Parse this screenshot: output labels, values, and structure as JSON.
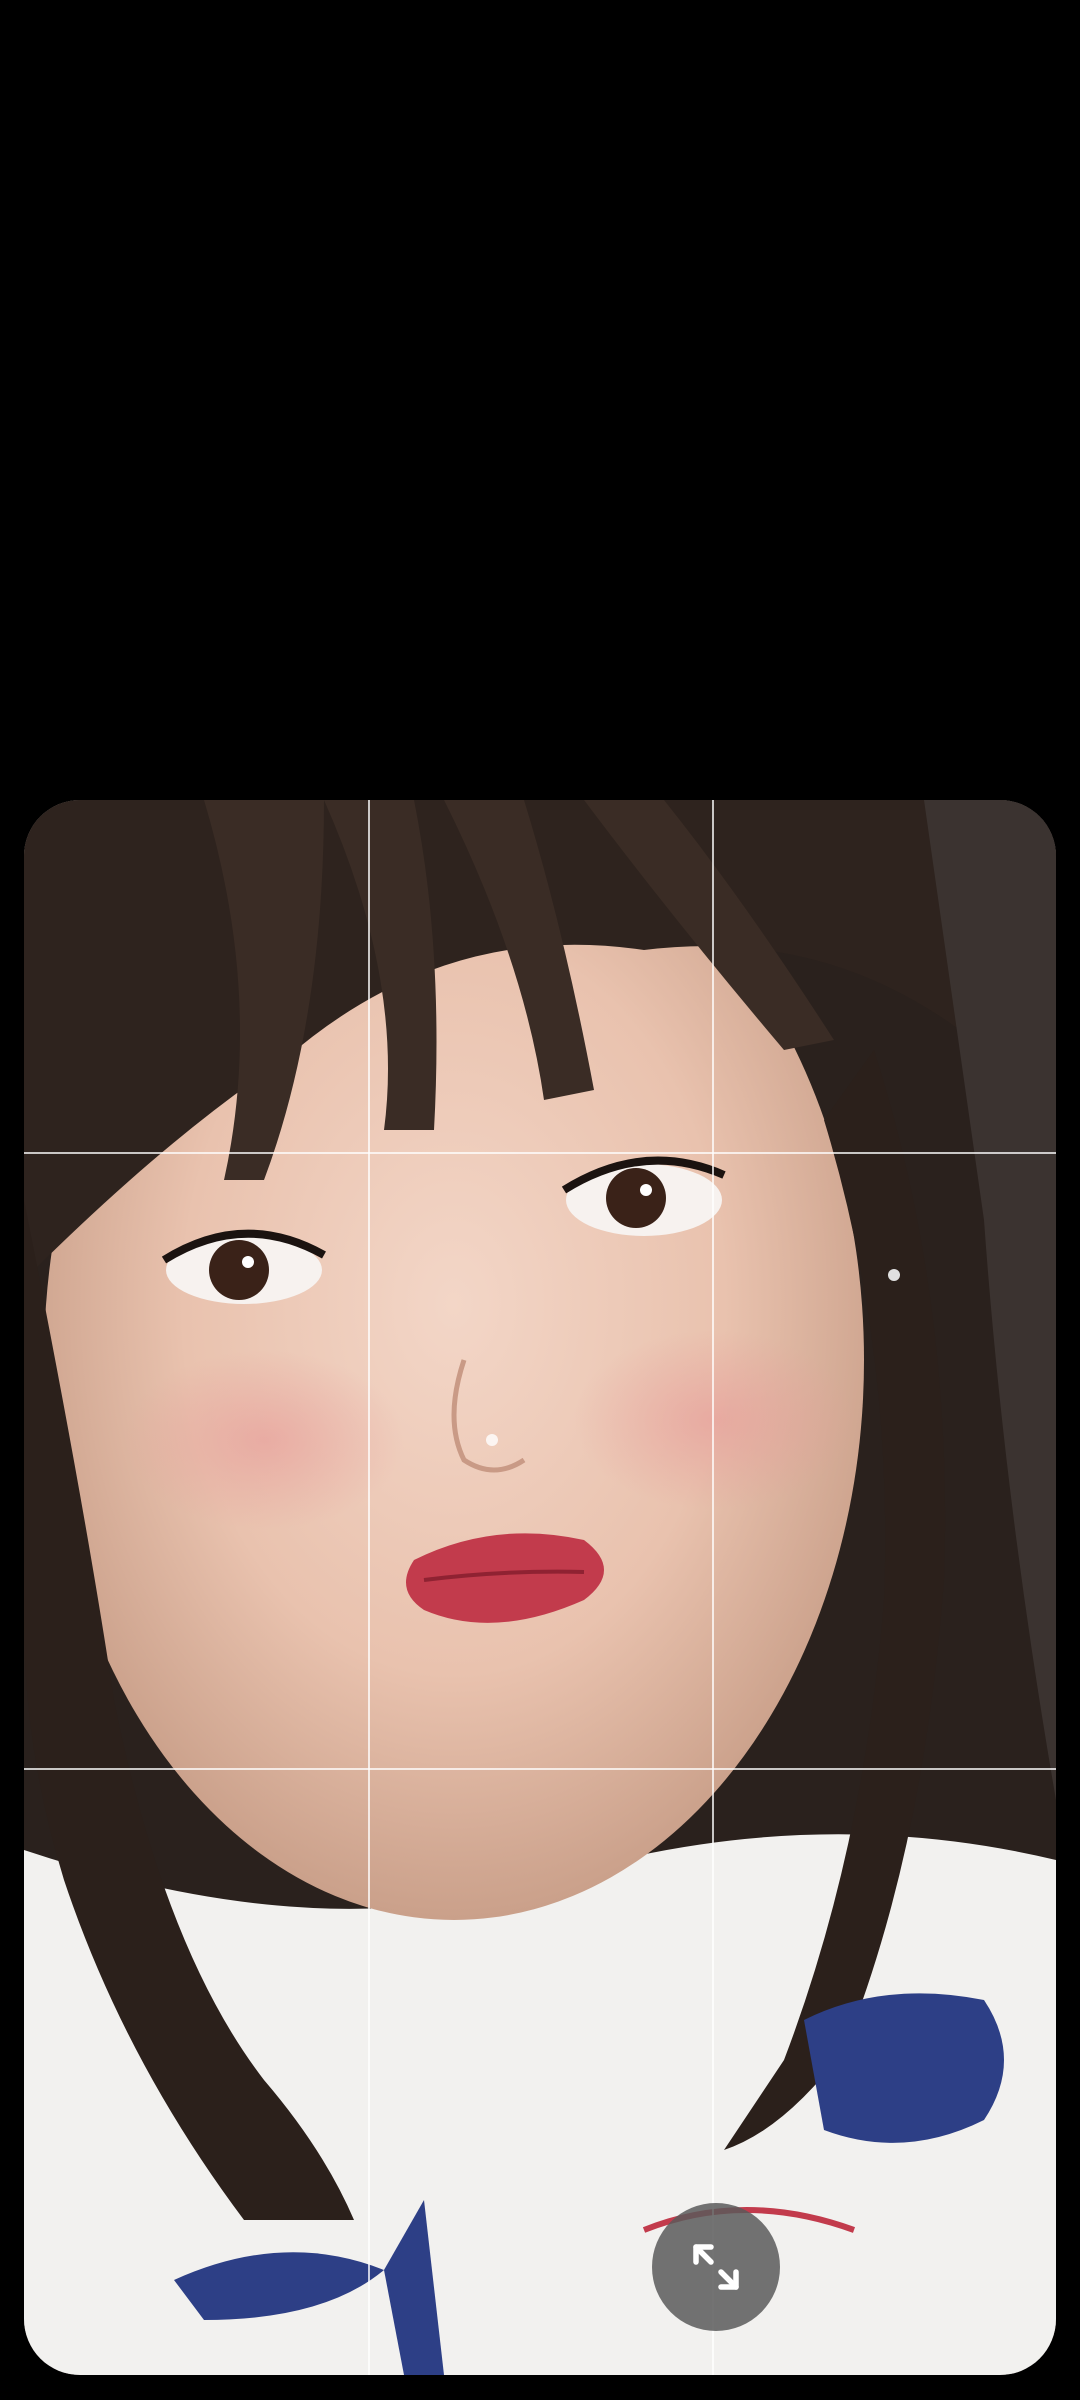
{
  "camera": {
    "grid": {
      "visible": true,
      "columns": 3,
      "rows": 3
    },
    "expand_button": {
      "icon": "expand-diagonal-arrows-icon"
    }
  }
}
